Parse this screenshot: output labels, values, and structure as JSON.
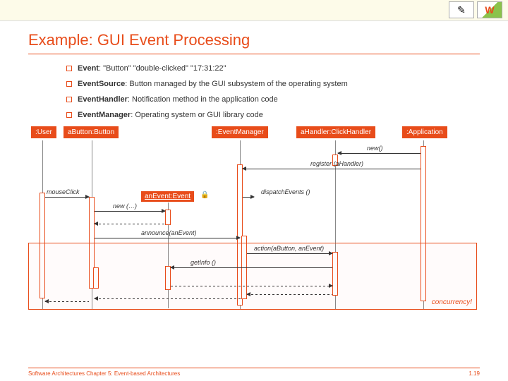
{
  "header": {
    "logo1_glyph": "✎",
    "logo2_glyph": "W"
  },
  "title": "Example: GUI Event Processing",
  "bullets": [
    {
      "strong": "Event",
      "rest": ": \"Button\" \"double-clicked\"  \"17:31:22\""
    },
    {
      "strong": "EventSource",
      "rest": ": Button managed by the GUI subsystem of the operating system"
    },
    {
      "strong": "EventHandler",
      "rest": ": Notification method in the application code"
    },
    {
      "strong": "EventManager",
      "rest": ": Operating system or GUI library code"
    }
  ],
  "lifelines": {
    "user": ":User",
    "button": "aButton:Button",
    "eventmgr": ":EventManager",
    "handler": "aHandler:ClickHandler",
    "app": ":Application"
  },
  "event_object": "anEvent:Event",
  "messages": {
    "new_handler": "new()",
    "register": "register (aHandler)",
    "mouseclick": "mouseClick",
    "dispatch": "dispatchEvents ()",
    "new_event": "new (…)",
    "announce": "announce(anEvent)",
    "action": "action(aButton, anEvent)",
    "getinfo": "getInfo ()"
  },
  "concurrency_label": "concurrency!",
  "lock_glyph": "🔒",
  "footer": {
    "left": "Software Architectures Chapter 5: Event-based Architectures",
    "right": "1.19"
  }
}
